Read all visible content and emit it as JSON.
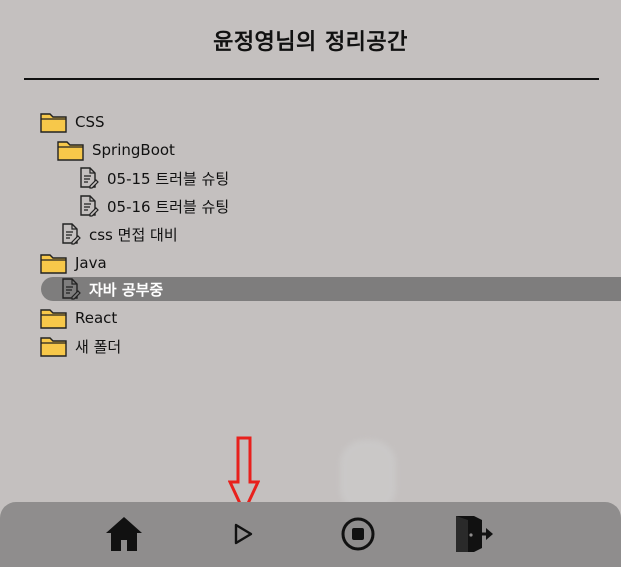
{
  "header": {
    "title": "윤정영님의 정리공간"
  },
  "tree": {
    "items": [
      {
        "label": "CSS",
        "type": "folder"
      },
      {
        "label": "SpringBoot",
        "type": "folder"
      },
      {
        "label": "05-15 트러블 슈팅",
        "type": "doc"
      },
      {
        "label": "05-16 트러블 슈팅",
        "type": "doc"
      },
      {
        "label": "css 면접 대비",
        "type": "doc"
      },
      {
        "label": "Java",
        "type": "folder"
      },
      {
        "label": "자바 공부중",
        "type": "doc",
        "selected": true
      },
      {
        "label": "React",
        "type": "folder"
      },
      {
        "label": "새 폴더",
        "type": "folder"
      }
    ]
  },
  "bottom_nav": {
    "items": [
      {
        "icon": "home-icon"
      },
      {
        "icon": "play-icon"
      },
      {
        "icon": "stop-circle-icon"
      },
      {
        "icon": "exit-door-icon"
      }
    ]
  },
  "colors": {
    "background": "#c4c0bf",
    "selected_row": "#7e7d7d",
    "bottom_bar": "#8f8d8d",
    "folder": "#f7c84a",
    "annotation_arrow": "#e8201c"
  }
}
